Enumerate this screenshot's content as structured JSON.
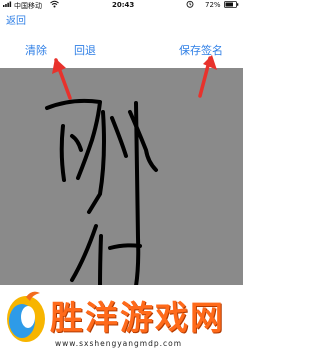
{
  "status_bar": {
    "carrier": "中国移动",
    "time": "20:43",
    "battery": "72%"
  },
  "nav": {
    "back_label": "返回"
  },
  "toolbar": {
    "clear_label": "清除",
    "undo_label": "回退",
    "save_label": "保存签名"
  },
  "colors": {
    "accent": "#2f7fe6",
    "canvas": "#8a8a8a",
    "arrow": "#e8322c",
    "watermark_text": "#ff6a1a"
  },
  "watermark": {
    "title": "胜洋游戏网",
    "url": "www.sxshengyangmdp.com"
  }
}
